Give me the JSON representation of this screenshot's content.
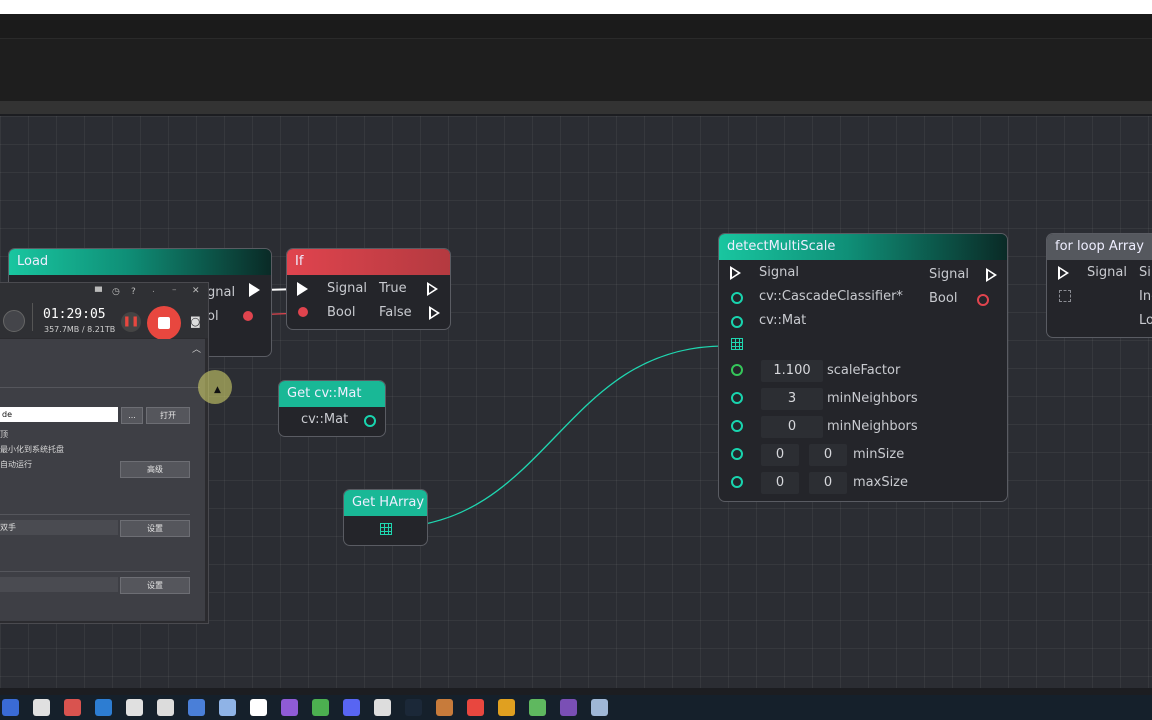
{
  "nodes": {
    "load": {
      "title": "Load",
      "out_signal": "Signal",
      "out_bool": "Bool",
      "signal_visible": "gnal",
      "bool_visible": "ol"
    },
    "if": {
      "title": "If",
      "signal": "Signal",
      "bool": "Bool",
      "true_label": "True",
      "false_label": "False"
    },
    "get_mat": {
      "title": "Get cv::Mat",
      "output": "cv::Mat"
    },
    "get_harray": {
      "title": "Get HArray"
    },
    "detect": {
      "title": "detectMultiScale",
      "in_signal": "Signal",
      "in_classifier": "cv::CascadeClassifier*",
      "in_mat": "cv::Mat",
      "out_signal": "Signal",
      "out_bool": "Bool",
      "scale_factor_value": "1.100",
      "scale_factor_label": "scaleFactor",
      "min_neighbors_value": "3",
      "min_neighbors_label": "minNeighbors",
      "flags_value": "0",
      "flags_label": "minNeighbors",
      "min_size_w": "0",
      "min_size_h": "0",
      "min_size_label": "minSize",
      "max_size_w": "0",
      "max_size_h": "0",
      "max_size_label": "maxSize"
    },
    "forloop": {
      "title": "for loop Array",
      "signal": "Signal",
      "out_signal_cut": "Si",
      "index_cut": "Inc",
      "loop_cut": "Lo"
    }
  },
  "recorder": {
    "timer": "01:29:05",
    "storage": "357.7MB / 8.21TB",
    "path_value": "de",
    "browse_label": "...",
    "open_label": "打开",
    "option1": "顶",
    "option2": "最小化到系统托盘",
    "option3": "自动运行",
    "advanced_label": "高级",
    "hotkey_label": "双手",
    "set_label_1": "设置",
    "set_label_2": "设置"
  },
  "colors": {
    "canvas": "#2b2d33",
    "accent": "#19d4ae",
    "if_header": "#e0444e",
    "record": "#e8473f"
  },
  "taskbar_icons": [
    "start-icon",
    "notes-icon",
    "app-icon",
    "mail-icon",
    "record-icon",
    "bird-icon",
    "tools-icon",
    "calc-icon",
    "file-icon",
    "visual-studio-icon",
    "minecraft-icon",
    "discord-icon",
    "unity-icon",
    "steam-icon",
    "recorder-app-icon",
    "record-red-icon",
    "chrome-icon",
    "box-icon",
    "media-icon",
    "window-icon"
  ]
}
